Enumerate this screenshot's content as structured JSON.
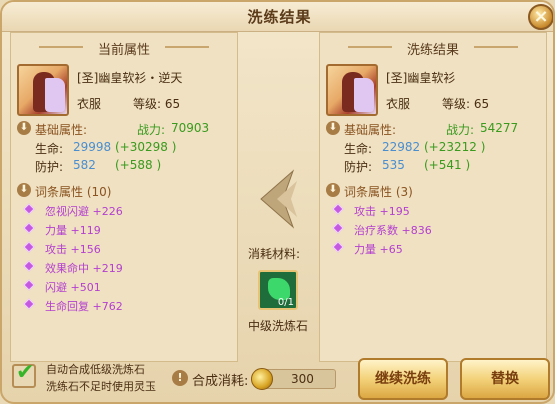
{
  "title": "洗练结果",
  "close_label": "×",
  "left": {
    "header": "当前属性",
    "item_name": "[圣]幽皇软衫・逆天",
    "item_type": "衣服",
    "item_level": "等级: 65",
    "base_label": "基础属性:",
    "power_label": "战力:",
    "power_value": "70903",
    "stats": [
      {
        "label": "生命:",
        "base": "29998",
        "bonus": "(+30298 )"
      },
      {
        "label": "防护:",
        "base": "582",
        "bonus": "(+588 )"
      }
    ],
    "attr_label": "词条属性 (10)",
    "attrs": [
      "忽视闪避 +226",
      "力量 +119",
      "攻击 +156",
      "效果命中 +219",
      "闪避 +501",
      "生命回复 +762"
    ]
  },
  "right": {
    "header": "洗练结果",
    "item_name": "[圣]幽皇软衫",
    "item_type": "衣服",
    "item_level": "等级: 65",
    "base_label": "基础属性:",
    "power_label": "战力:",
    "power_value": "54277",
    "stats": [
      {
        "label": "生命:",
        "base": "22982",
        "bonus": "(+23212 )"
      },
      {
        "label": "防护:",
        "base": "535",
        "bonus": "(+541 )"
      }
    ],
    "attr_label": "词条属性 (3)",
    "attrs": [
      "攻击 +195",
      "治疗系数 +836",
      "力量 +65"
    ]
  },
  "material": {
    "label": "消耗材料:",
    "count": "0/1",
    "name": "中级洗炼石"
  },
  "bottom": {
    "option_line1": "自动合成低级洗炼石",
    "option_line2": "洗练石不足时使用灵玉",
    "cost_label": "合成消耗:",
    "cost_value": "300",
    "continue_label": "继续洗练",
    "swap_label": "替换"
  },
  "colors": {
    "power": "#3a9a1e",
    "stat_base": "#4a8ed0",
    "attr": "#b43fcf",
    "button": "#f3d27a"
  }
}
